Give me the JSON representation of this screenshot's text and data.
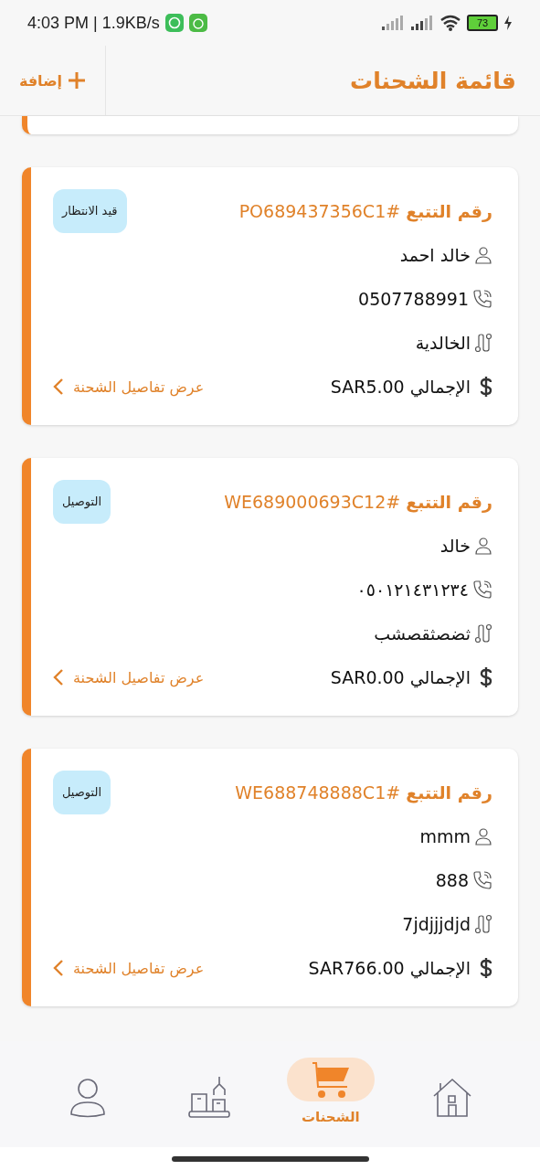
{
  "status_bar": {
    "time": "4:03 PM | 1.9KB/s",
    "battery": "73"
  },
  "header": {
    "title": "قائمة الشحنات",
    "add_button": "إضافة"
  },
  "shipments": [
    {
      "tracking": "**رقم التتبع** #PO689437356C1",
      "status": "قيد الانتظار",
      "name": "خالد احمد",
      "phone": "0507788991",
      "address": "الخالدية",
      "total": "الإجمالي SAR5.00",
      "details_link": "عرض تفاصيل الشحنة"
    },
    {
      "tracking": "**رقم التتبع** #WE689000693C12",
      "status": "التوصيل",
      "name": "خالد",
      "phone": "٠٥٠١٢١٤٣١٢٣٤",
      "address": "ثضصثقصشب",
      "total": "الإجمالي SAR0.00",
      "details_link": "عرض تفاصيل الشحنة"
    },
    {
      "tracking": "**رقم التتبع** #WE688748888C1",
      "status": "التوصيل",
      "name": "mmm",
      "phone": "888",
      "address": "7jdjjjdjd",
      "total": "الإجمالي SAR766.00",
      "details_link": "عرض تفاصيل الشحنة"
    }
  ],
  "bottom_nav": [
    {
      "kind": "home",
      "selected": false
    },
    {
      "kind": "shipments",
      "label": "الشحنات",
      "selected": true
    },
    {
      "kind": "warehouse",
      "selected": false
    },
    {
      "kind": "profile",
      "selected": false
    }
  ]
}
